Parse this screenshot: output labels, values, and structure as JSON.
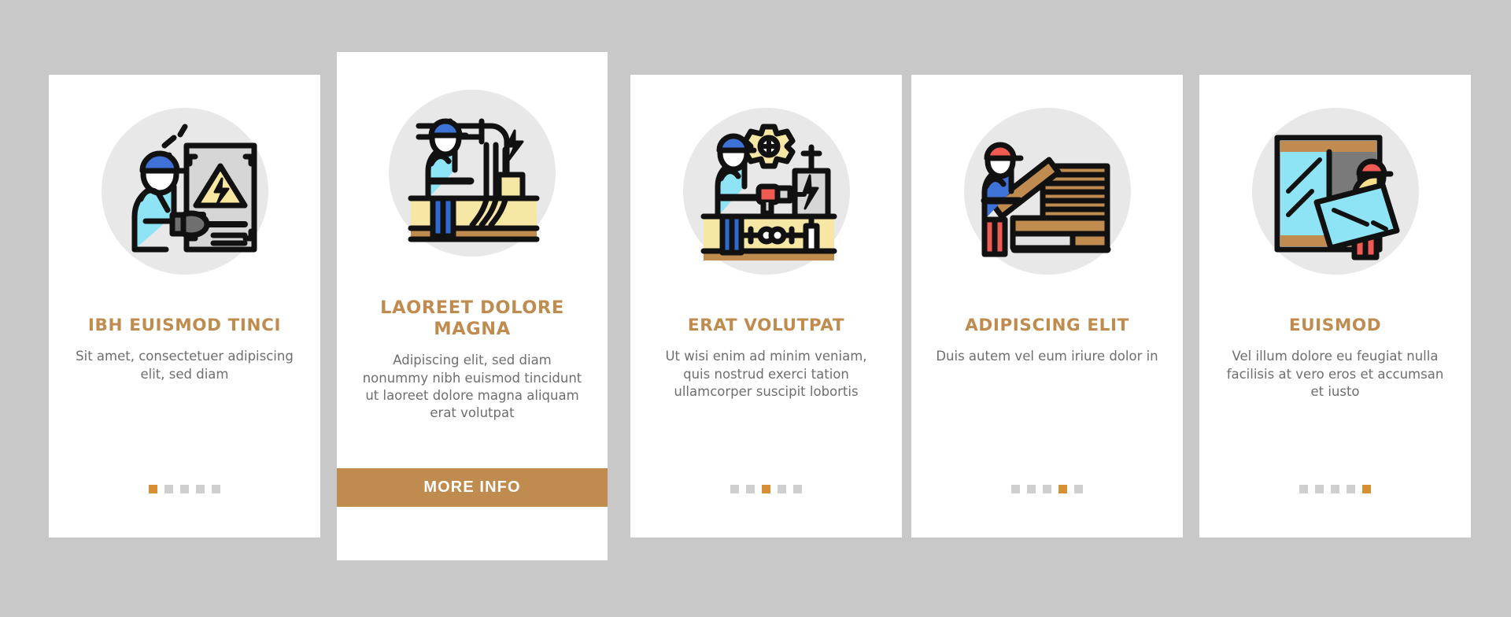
{
  "canvas": {
    "background_color": "#c8c8c8",
    "card_background": "#ffffff",
    "accent_color": "#c08b4e",
    "dot_active_color": "#d88f34",
    "dot_inactive_color": "#cfcfcf",
    "title_color": "#c08b4e",
    "body_color": "#6e6e6e",
    "illustration_disc_color": "#e8e8e8"
  },
  "cards": [
    {
      "id": "card-1",
      "variant": "standard",
      "icon_name": "electrician-inspecting-panel-icon",
      "title": "IBH EUISMOD TINCI",
      "description": "Sit amet, consectetuer adipiscing elit, sed diam",
      "dots": {
        "total": 5,
        "active_index": 0
      },
      "cta": null
    },
    {
      "id": "card-2",
      "variant": "featured",
      "icon_name": "worker-cable-installation-icon",
      "title": "LAOREET DOLORE MAGNA",
      "description": "Adipiscing elit, sed diam nonummy nibh euismod tincidunt ut laoreet dolore magna aliquam erat volutpat",
      "dots": null,
      "cta": {
        "label": "MORE INFO"
      }
    },
    {
      "id": "card-3",
      "variant": "standard",
      "icon_name": "worker-drill-electrical-post-icon",
      "title": "ERAT VOLUTPAT",
      "description": "Ut wisi enim ad minim veniam, quis nostrud exerci tation ullamcorper suscipit lobortis",
      "dots": {
        "total": 5,
        "active_index": 2
      },
      "cta": null
    },
    {
      "id": "card-4",
      "variant": "standard",
      "icon_name": "worker-carrying-lumber-icon",
      "title": "ADIPISCING ELIT",
      "description": "Duis autem vel eum iriure dolor in",
      "dots": {
        "total": 5,
        "active_index": 3
      },
      "cta": null
    },
    {
      "id": "card-5",
      "variant": "standard",
      "icon_name": "worker-installing-glass-panel-icon",
      "title": "EUISMOD",
      "description": "Vel illum dolore eu feugiat nulla facilisis at vero eros et accumsan et iusto",
      "dots": {
        "total": 5,
        "active_index": 4
      },
      "cta": null
    }
  ]
}
